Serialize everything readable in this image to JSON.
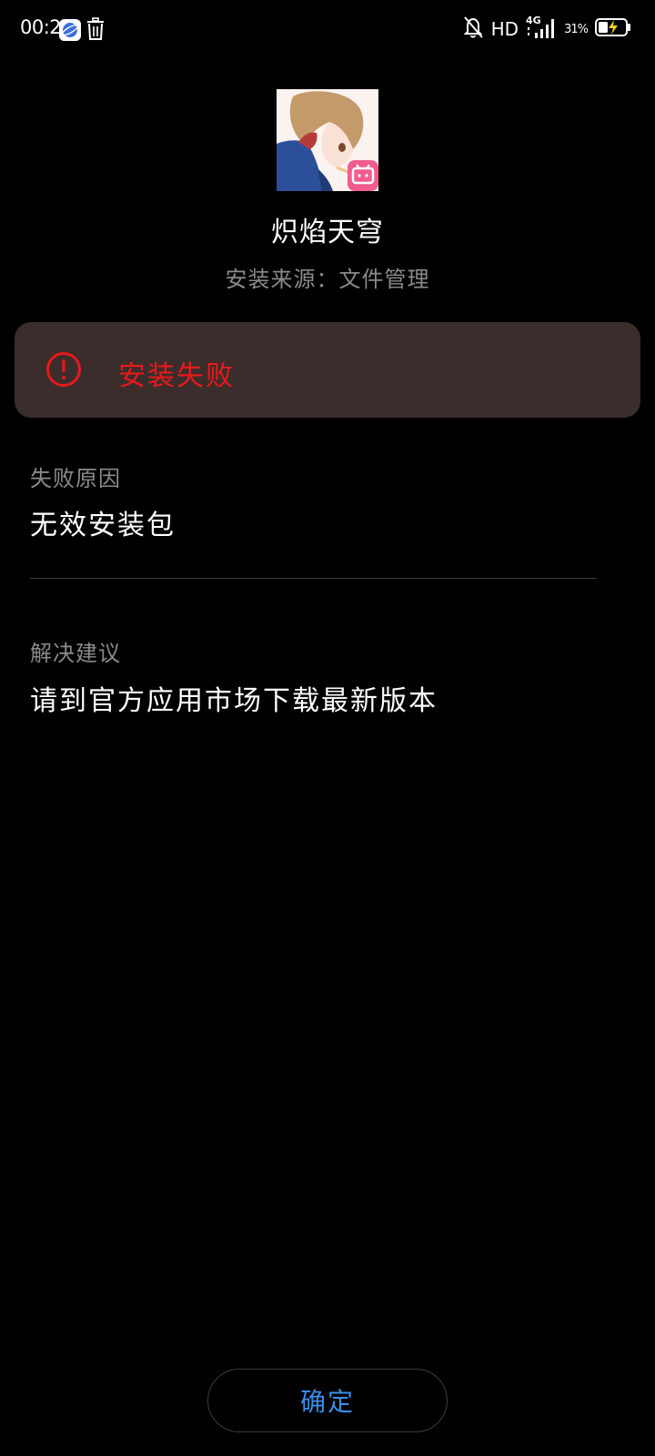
{
  "status_bar": {
    "time": "00:21",
    "network": "HD",
    "signal_type": "4G",
    "battery_percent": "31%",
    "icons": [
      "browser-app-icon",
      "trash-icon",
      "mute-bell-icon",
      "signal-icon",
      "battery-charging-icon"
    ]
  },
  "app": {
    "name": "炽焰天穹",
    "source": "安装来源：文件管理",
    "icon": "app-icon-anime-girl"
  },
  "error": {
    "icon": "exclamation-circle-icon",
    "title": "安装失败",
    "color": "#e8191c"
  },
  "failure_reason": {
    "label": "失败原因",
    "value": "无效安装包"
  },
  "suggestion": {
    "label": "解决建议",
    "value": "请到官方应用市场下载最新版本"
  },
  "confirm_button": {
    "label": "确定",
    "color": "#3b8ee8"
  }
}
